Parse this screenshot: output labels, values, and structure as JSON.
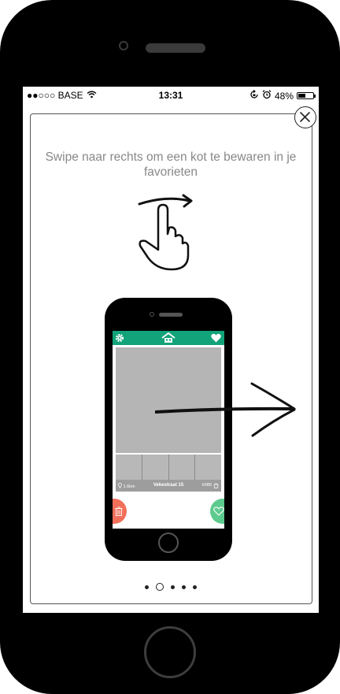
{
  "statusbar": {
    "carrier": "●●○○○ BASE",
    "time": "13:31",
    "battery": "48%",
    "battery_level": 0.48,
    "wifi_icon": "wifi-icon",
    "icons": [
      "lock-rotation-icon",
      "alarm-icon",
      "battery-icon"
    ]
  },
  "onboarding": {
    "instruction": "Swipe naar rechts om een kot te bewaren in je favorieten",
    "illustration": "swipe-right-hand-icon",
    "page_count": 5,
    "current_page": 2
  },
  "mini_app": {
    "header_icons": [
      "gear-icon",
      "house-logo-icon",
      "heart-icon"
    ],
    "distance": "1.6km",
    "street": "Vekestraat 15",
    "price": "€480",
    "brand_color": "#12a37a",
    "dislike_color": "#f26f5a",
    "like_color": "#5dcb8e"
  },
  "colors": {
    "brand": "#12a37a",
    "dislike": "#f26f5a",
    "like": "#5dcb8e",
    "text_muted": "#888888"
  }
}
